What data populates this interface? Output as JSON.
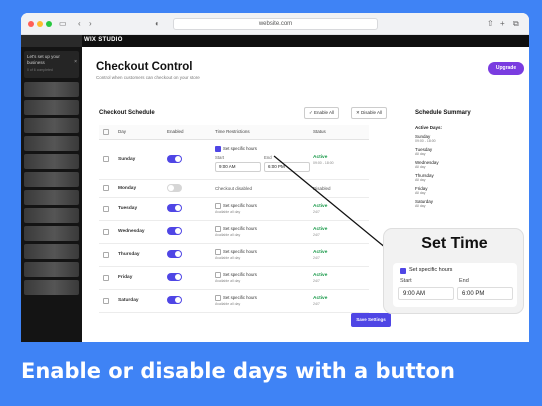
{
  "browser": {
    "url": "website.com"
  },
  "sidebar": {
    "card_title": "Let's set up your business",
    "card_subtitle": "0 of 6 completed",
    "close_glyph": "×"
  },
  "topbar": {
    "logo": "WIX STUDIO"
  },
  "page": {
    "title": "Checkout Control",
    "subtitle": "Control when customers can checkout on your store",
    "upgrade_label": "Upgrade"
  },
  "schedule": {
    "title": "Checkout Schedule",
    "enable_all": "Enable All",
    "disable_all": "Disable All",
    "columns": [
      "Day",
      "Enabled",
      "Time Restrictions",
      "Status"
    ],
    "set_hours_label": "Set specific hours",
    "available_all_day": "Available all day",
    "start_label": "Start",
    "end_label": "End",
    "sunday_start": "9:00 AM",
    "sunday_end": "6:00 PM",
    "checkout_disabled": "Checkout disabled",
    "rows": [
      {
        "day": "Sunday",
        "enabled": true,
        "status": "Active",
        "hours": "09:00 - 18:00"
      },
      {
        "day": "Monday",
        "enabled": false,
        "status": "Disabled",
        "hours": ""
      },
      {
        "day": "Tuesday",
        "enabled": true,
        "status": "Active",
        "hours": "24/7"
      },
      {
        "day": "Wednesday",
        "enabled": true,
        "status": "Active",
        "hours": "24/7"
      },
      {
        "day": "Thursday",
        "enabled": true,
        "status": "Active",
        "hours": "24/7"
      },
      {
        "day": "Friday",
        "enabled": true,
        "status": "Active",
        "hours": "24/7"
      },
      {
        "day": "Saturday",
        "enabled": true,
        "status": "Active",
        "hours": "24/7"
      }
    ],
    "save_label": "Save Settings"
  },
  "summary": {
    "title": "Schedule Summary",
    "active_days_label": "Active Days:",
    "days": [
      {
        "day": "Sunday",
        "value": "09:00 - 18:00"
      },
      {
        "day": "Tuesday",
        "value": "All day"
      },
      {
        "day": "Wednesday",
        "value": "All day"
      },
      {
        "day": "Thursday",
        "value": "All day"
      },
      {
        "day": "Friday",
        "value": "All day"
      },
      {
        "day": "Saturday",
        "value": "All day"
      }
    ]
  },
  "callout": {
    "title": "Set Time",
    "checkbox_label": "Set specific hours",
    "start_label": "Start",
    "end_label": "End",
    "start_value": "9:00 AM",
    "end_value": "6:00 PM"
  },
  "caption": "Enable or disable days with a button",
  "colors": {
    "background": "#3f83f5",
    "accent": "#4f46e5",
    "upgrade": "#7a3ce0",
    "active": "#1a9a4a"
  }
}
